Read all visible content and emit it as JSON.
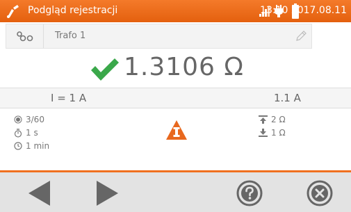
{
  "header": {
    "title": "Podgląd rejestracji",
    "datetime": "13:10 2017.08.11",
    "color": "#f06a1c"
  },
  "object": {
    "name": "Trafo 1"
  },
  "result": {
    "value": "1.3106 Ω",
    "status_color": "#3aa84a"
  },
  "current": {
    "set": "I = 1 A",
    "measured": "1.1 A"
  },
  "params_left": [
    {
      "icon": "measurement-count-icon",
      "text": "3/60"
    },
    {
      "icon": "timer-icon",
      "text": "1 s"
    },
    {
      "icon": "clock-icon",
      "text": "1 min"
    }
  ],
  "params_right": [
    {
      "icon": "upper-resistance-limit-icon",
      "text": "2 Ω"
    },
    {
      "icon": "lower-resistance-limit-icon",
      "text": "1 Ω"
    }
  ],
  "icons": {
    "warning": "high-voltage-warning-icon",
    "accent": "#e8681e"
  }
}
